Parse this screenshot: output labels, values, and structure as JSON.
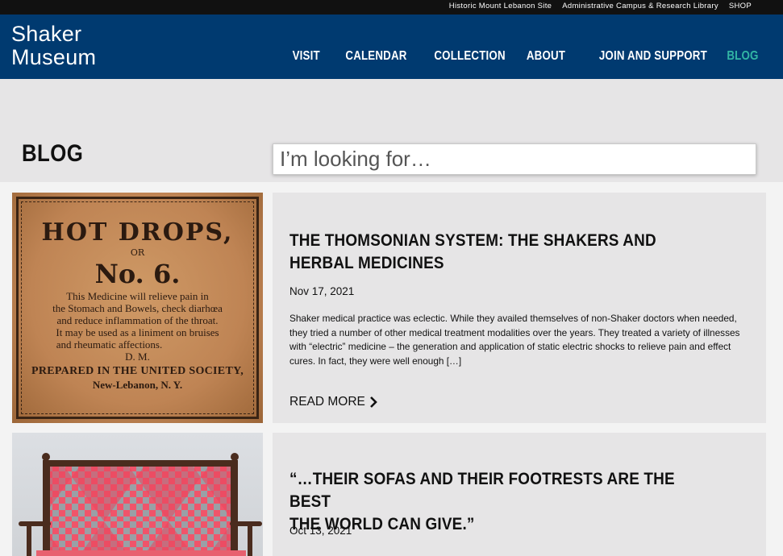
{
  "utility": {
    "links": [
      "Historic Mount Lebanon Site",
      "Administrative Campus & Research Library",
      "SHOP"
    ]
  },
  "header": {
    "logo_line1": "Shaker",
    "logo_line2": "Museum",
    "nav": [
      {
        "label": "VISIT",
        "active": false
      },
      {
        "label": "CALENDAR",
        "active": false
      },
      {
        "label": "COLLECTION",
        "active": false
      },
      {
        "label": "ABOUT",
        "active": false
      },
      {
        "label": "JOIN AND SUPPORT",
        "active": false
      },
      {
        "label": "BLOG",
        "active": true
      }
    ],
    "colors": {
      "bar": "#003a70",
      "active": "#32b5a4",
      "utility": "#111111"
    }
  },
  "page": {
    "title": "BLOG",
    "search_placeholder": "I’m looking for…"
  },
  "posts": [
    {
      "title_line1": "THE THOMSONIAN SYSTEM: THE SHAKERS AND",
      "title_line2": "HERBAL MEDICINES",
      "date": "Nov 17, 2021",
      "excerpt": "Shaker medical practice was eclectic. While they availed themselves of non-Shaker doctors when needed, they tried a number of other medical treatment modalities over the years.  They treated a variety of illnesses with “electric” medicine – the generation and application of static electric shocks to relieve pain and effect cures. In fact, they were well enough […]",
      "read_more": "READ MORE",
      "image": {
        "line1": "HOT DROPS,",
        "line2": "OR",
        "line3": "No. 6.",
        "body": [
          "This Medicine will relieve pain in",
          "the Stomach and Bowels, check diarhœa",
          "and reduce inflammation of the throat.",
          "It may be used as a liniment on bruises",
          "and rheumatic affections."
        ],
        "initials": "D. M.",
        "prepared": "PREPARED IN THE UNITED SOCIETY,",
        "place": "New-Lebanon, N. Y."
      }
    },
    {
      "title_line1": "“…THEIR SOFAS AND THEIR FOOTRESTS ARE THE BEST",
      "title_line2": "THE WORLD CAN GIVE.”",
      "date": "Oct 13, 2021"
    }
  ]
}
